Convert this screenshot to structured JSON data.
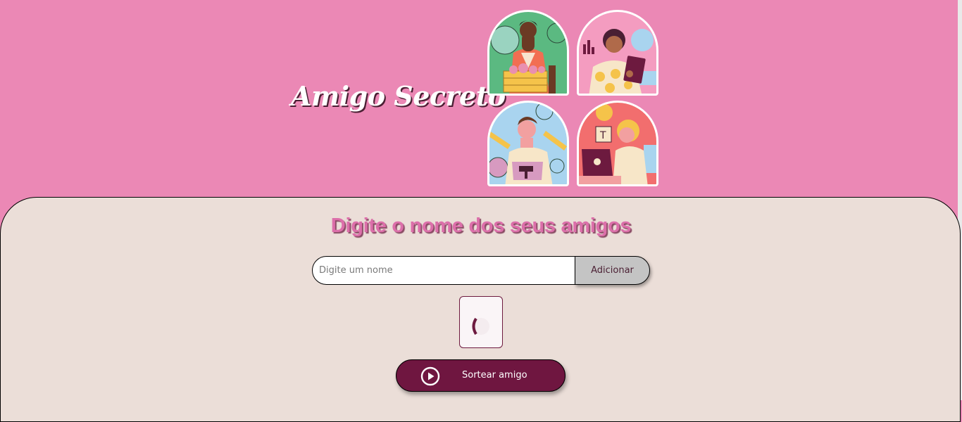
{
  "header": {
    "title": "Amigo Secreto",
    "illustrations": [
      {
        "name": "gardener-illustration",
        "icon": "person-with-plant-box-icon"
      },
      {
        "name": "analyst-illustration",
        "icon": "person-with-tablet-icon"
      },
      {
        "name": "builder-illustration",
        "icon": "person-with-hammer-icon"
      },
      {
        "name": "designer-illustration",
        "icon": "person-with-laptop-icon"
      }
    ]
  },
  "main": {
    "heading": "Digite o nome dos seus amigos",
    "input": {
      "placeholder": "Digite um nome",
      "value": ""
    },
    "add_button": "Adicionar",
    "draw_button": {
      "label": "Sortear amigo",
      "icon": "play-circle-icon"
    }
  },
  "colors": {
    "page_background": "#EB88B5",
    "panel_background": "#EBDED8",
    "heading": "#DC6FAA",
    "primary_button": "#6F1640",
    "secondary_button": "#C4C4C4"
  }
}
